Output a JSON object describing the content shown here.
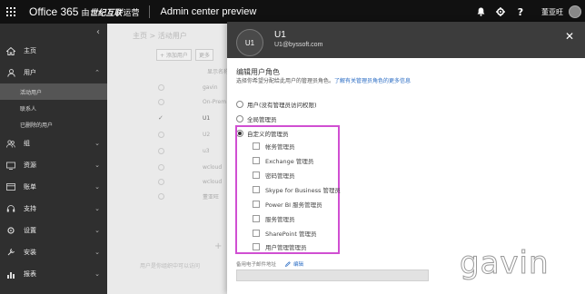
{
  "topbar": {
    "brand": "Office 365",
    "brand_sub": "由",
    "brand_logo": "世纪互联",
    "brand_suffix": "运营",
    "app_title": "Admin center preview",
    "icons": [
      "bell-icon",
      "gear-icon",
      "help-icon"
    ],
    "help_glyph": "?",
    "username": "董亚旺"
  },
  "nav": {
    "collapse_glyph": "‹",
    "items": [
      {
        "label": "主页",
        "icon": "home-icon"
      },
      {
        "label": "用户",
        "icon": "user-icon",
        "expanded": true
      },
      {
        "label": "组",
        "icon": "group-icon"
      },
      {
        "label": "资源",
        "icon": "resources-icon"
      },
      {
        "label": "账单",
        "icon": "billing-icon"
      },
      {
        "label": "支持",
        "icon": "support-icon"
      },
      {
        "label": "设置",
        "icon": "settings-icon"
      },
      {
        "label": "安装",
        "icon": "setup-icon"
      },
      {
        "label": "报表",
        "icon": "reports-icon"
      }
    ],
    "sub_items": [
      "活动用户",
      "联系人",
      "已删除的用户"
    ],
    "chevron": "⌄"
  },
  "background": {
    "breadcrumb": "主页 > 活动用户",
    "toolbar": [
      "+ 添加用户",
      "更多"
    ],
    "column_header": "显示名称",
    "rows": [
      "gavin",
      "On-Prem",
      "U1",
      "U2",
      "u3",
      "wcloud",
      "wcloud",
      "董亚旺"
    ],
    "add_glyph": "+",
    "footer": "用户是你组织中可以访问"
  },
  "panel": {
    "avatar_initials": "U1",
    "user_name": "U1",
    "user_email": "U1@byssoft.com",
    "close_glyph": "✕",
    "title": "编辑用户角色",
    "description": "选择你希望分配给此用户的管理员角色。",
    "description_link": "了解有关管理员角色的更多信息",
    "roles": [
      {
        "label": "用户(没有管理员访问权限)",
        "selected": false
      },
      {
        "label": "全局管理员",
        "selected": false
      },
      {
        "label": "自定义的管理员",
        "selected": true
      }
    ],
    "custom_roles": [
      "帐务管理员",
      "Exchange 管理员",
      "密码管理员",
      "Skype for Business 管理员",
      "Power BI 服务管理员",
      "服务管理员",
      "SharePoint 管理员",
      "用户管理管理员"
    ],
    "alt_email_label": "备用电子邮件地址",
    "edit_label": "编辑",
    "alt_email_value": ""
  },
  "watermark": "gavin",
  "colors": {
    "topbar": "#111111",
    "leftnav": "#2f2f2f",
    "panel_header": "#3c3c3c",
    "highlight": "#d04fd2",
    "link": "#2a6cc4"
  }
}
